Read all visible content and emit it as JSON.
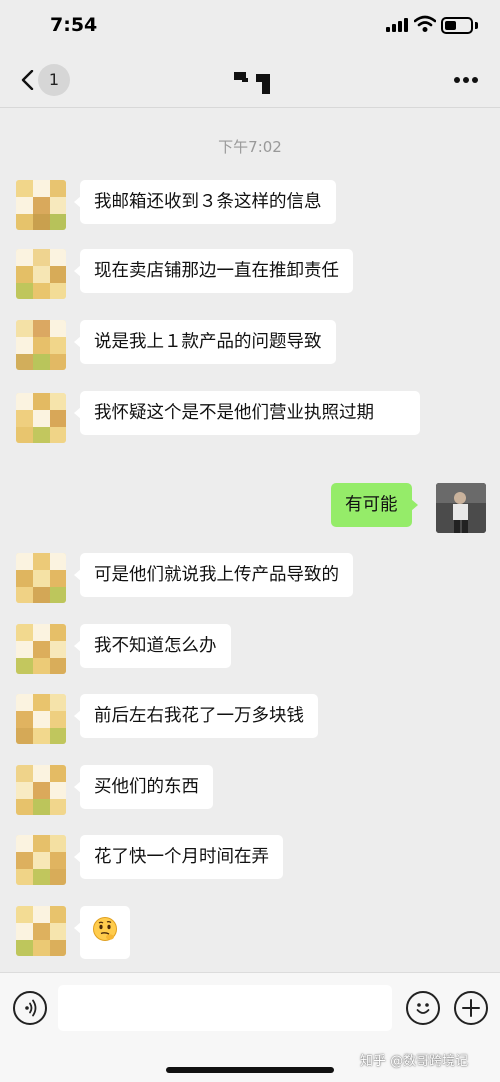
{
  "status_bar": {
    "time": "7:54"
  },
  "nav": {
    "unread_count": "1"
  },
  "chat": {
    "timestamp": "下午7:02",
    "messages": [
      {
        "side": "left",
        "text": "我邮箱还收到３条这样的信息"
      },
      {
        "side": "left",
        "text": "现在卖店铺那边一直在推卸责任"
      },
      {
        "side": "left",
        "text": "说是我上１款产品的问题导致"
      },
      {
        "side": "left",
        "text": "我怀疑这个是不是他们营业执照过期"
      },
      {
        "side": "right",
        "text": "有可能"
      },
      {
        "side": "left",
        "text": "可是他们就说我上传产品导致的"
      },
      {
        "side": "left",
        "text": "我不知道怎么办"
      },
      {
        "side": "left",
        "text": "前后左右我花了一万多块钱"
      },
      {
        "side": "left",
        "text": "买他们的东西"
      },
      {
        "side": "left",
        "text": "花了快一个月时间在弄"
      },
      {
        "side": "left",
        "text": "🤔"
      }
    ]
  },
  "input": {
    "placeholder": ""
  },
  "watermark": "知乎 @数哥跨境记",
  "colors": {
    "background": "#ededed",
    "bubble_received": "#ffffff",
    "bubble_sent": "#95ec69",
    "timestamp": "#999999"
  }
}
